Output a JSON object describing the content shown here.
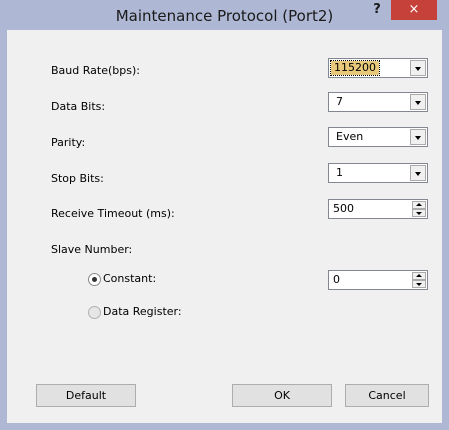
{
  "window": {
    "title": "Maintenance Protocol (Port2)",
    "help_label": "?",
    "close_label": "×"
  },
  "fields": {
    "baud_rate": {
      "label": "Baud Rate(bps):",
      "value": "115200"
    },
    "data_bits": {
      "label": "Data Bits:",
      "value": "7"
    },
    "parity": {
      "label": "Parity:",
      "value": "Even"
    },
    "stop_bits": {
      "label": "Stop Bits:",
      "value": "1"
    },
    "receive_timeout": {
      "label": "Receive Timeout (ms):",
      "value": "500"
    },
    "slave_number": {
      "label": "Slave Number:",
      "constant": {
        "label": "Constant:",
        "selected": true,
        "value": "0"
      },
      "data_register": {
        "label": "Data Register:",
        "selected": false
      }
    }
  },
  "buttons": {
    "default": "Default",
    "ok": "OK",
    "cancel": "Cancel"
  }
}
